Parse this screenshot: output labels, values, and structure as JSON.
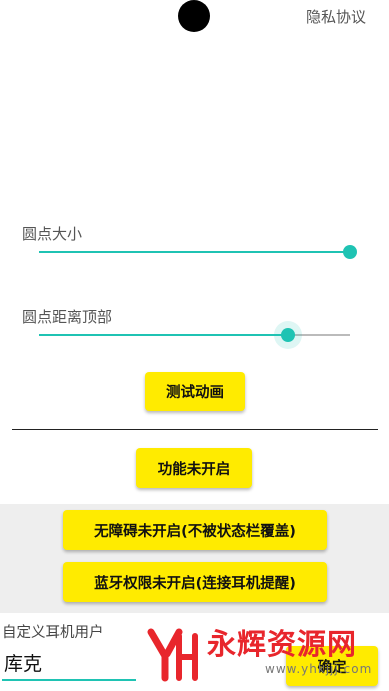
{
  "header": {
    "privacy_link": "隐私协议"
  },
  "sliders": {
    "dot_size": {
      "label": "圆点大小",
      "value_fraction": 1.0
    },
    "dot_top_distance": {
      "label": "圆点距离顶部",
      "value_fraction": 0.8
    }
  },
  "buttons": {
    "test_animation": "测试动画",
    "function_status": "功能未开启",
    "accessibility_status": "无障碍未开启(不被状态栏覆盖)",
    "bluetooth_status": "蓝牙权限未开启(连接耳机提醒)",
    "confirm": "确定"
  },
  "custom_user": {
    "label": "自定义耳机用户",
    "value": "库克"
  },
  "watermark": {
    "title": "永辉资源网",
    "url": "www.yhkjjj.com"
  },
  "colors": {
    "accent": "#1fc3b3",
    "button": "#ffeb00",
    "watermark_red": "#e8262c"
  }
}
